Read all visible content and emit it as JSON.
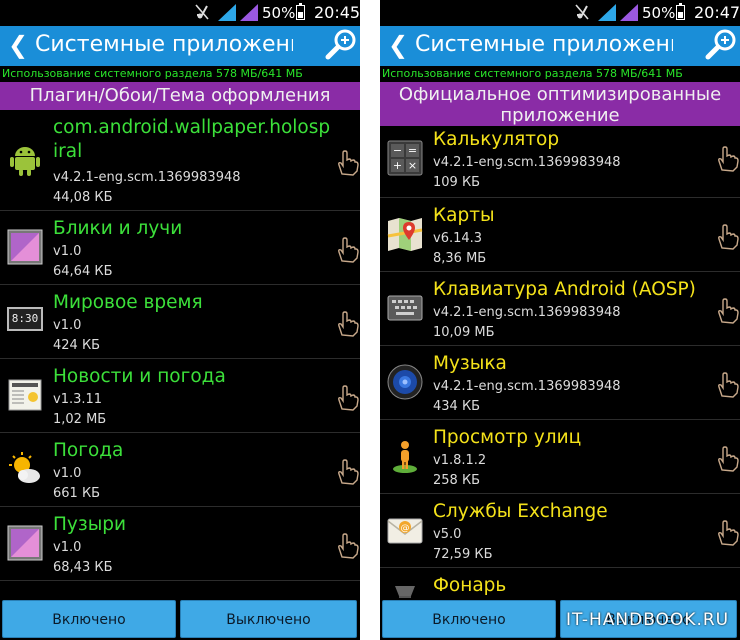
{
  "left": {
    "status": {
      "battery": "50%",
      "time": "20:45"
    },
    "title": "Системные приложения",
    "usage": "Использование системного раздела 578 МБ/641 МБ",
    "section": "Плагин/Обои/Тема оформления",
    "items": [
      {
        "name": "com.android.wallpaper.holospiral",
        "version": "v4.2.1-eng.scm.1369983948",
        "size": "44,08 КБ",
        "icon": "android-robot-icon"
      },
      {
        "name": "Блики и лучи",
        "version": "v1.0",
        "size": "64,64 КБ",
        "icon": "wallpaper-picture-icon"
      },
      {
        "name": "Мировое время",
        "version": "v1.0",
        "size": "424 КБ",
        "icon": "clock-8-30-icon",
        "icon_text": "8:30"
      },
      {
        "name": "Новости и погода",
        "version": "v1.3.11",
        "size": "1,02 МБ",
        "icon": "newspaper-icon"
      },
      {
        "name": "Погода",
        "version": "v1.0",
        "size": "661 КБ",
        "icon": "sun-cloud-icon"
      },
      {
        "name": "Пузыри",
        "version": "v1.0",
        "size": "68,43 КБ",
        "icon": "wallpaper-picture-icon"
      }
    ],
    "buttons": {
      "enabled": "Включено",
      "disabled": "Выключено"
    }
  },
  "right": {
    "status": {
      "battery": "50%",
      "time": "20:47"
    },
    "title": "Системные приложения",
    "usage": "Использование системного раздела 578 МБ/641 МБ",
    "section": "Официальное оптимизированные приложение",
    "items": [
      {
        "name": "Калькулятор",
        "version": "v4.2.1-eng.scm.1369983948",
        "size": "109 КБ",
        "icon": "calculator-icon"
      },
      {
        "name": "Карты",
        "version": "v6.14.3",
        "size": "8,36 МБ",
        "icon": "maps-icon"
      },
      {
        "name": "Клавиатура Android (AOSP)",
        "version": "v4.2.1-eng.scm.1369983948",
        "size": "10,09 МБ",
        "icon": "keyboard-icon"
      },
      {
        "name": "Музыка",
        "version": "v4.2.1-eng.scm.1369983948",
        "size": "434 КБ",
        "icon": "speaker-icon"
      },
      {
        "name": "Просмотр улиц",
        "version": "v1.8.1.2",
        "size": "258 КБ",
        "icon": "street-view-pegman-icon"
      },
      {
        "name": "Службы Exchange",
        "version": "v5.0",
        "size": "72,59 КБ",
        "icon": "email-envelope-icon"
      },
      {
        "name": "Фонарь",
        "version": "",
        "size": "",
        "icon": "flashlight-icon"
      }
    ],
    "buttons": {
      "enabled": "Включено",
      "disabled": "Выключено"
    }
  },
  "watermark": "IT-HANDBOOK.RU",
  "colors": {
    "titlebar": "#1a8ed8",
    "section": "#8a2ca6",
    "left_names": "#3ce03a",
    "right_names": "#f4e21a",
    "button": "#3fa9e6"
  }
}
